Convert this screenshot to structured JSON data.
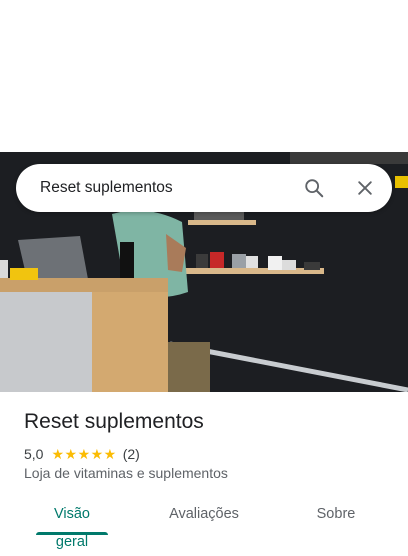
{
  "search": {
    "query": "Reset suplementos"
  },
  "place": {
    "name": "Reset suplementos",
    "rating": "5,0",
    "stars": "★★★★★",
    "review_count": "(2)",
    "category": "Loja de vitaminas e suplementos"
  },
  "tabs": [
    {
      "label": "Visão geral",
      "active": true
    },
    {
      "label": "Avaliações",
      "active": false
    },
    {
      "label": "Sobre",
      "active": false
    }
  ],
  "colors": {
    "accent": "#00796b",
    "star": "#fbbc04"
  },
  "icons": {
    "search": "search-icon",
    "clear": "close-icon"
  }
}
